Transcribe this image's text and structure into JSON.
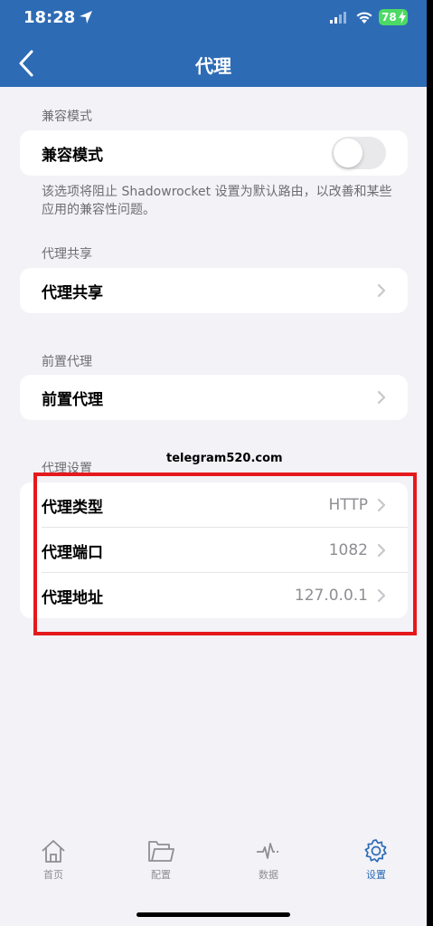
{
  "status_bar": {
    "time": "18:28",
    "battery": "78"
  },
  "nav": {
    "title": "代理"
  },
  "sections": {
    "compat": {
      "header": "兼容模式",
      "row_label": "兼容模式",
      "toggle_on": false,
      "footnote": "该选项将阻止 Shadowrocket 设置为默认路由，以改善和某些应用的兼容性问题。"
    },
    "share": {
      "header": "代理共享",
      "row_label": "代理共享"
    },
    "front": {
      "header": "前置代理",
      "row_label": "前置代理"
    },
    "settings": {
      "header": "代理设置",
      "rows": [
        {
          "label": "代理类型",
          "value": "HTTP"
        },
        {
          "label": "代理端口",
          "value": "1082"
        },
        {
          "label": "代理地址",
          "value": "127.0.0.1"
        }
      ]
    }
  },
  "watermark": "telegram520.com",
  "tabbar": {
    "tabs": [
      {
        "label": "首页",
        "icon": "home-icon"
      },
      {
        "label": "配置",
        "icon": "folder-icon"
      },
      {
        "label": "数据",
        "icon": "activity-icon"
      },
      {
        "label": "设置",
        "icon": "gear-icon"
      }
    ],
    "active_index": 3
  },
  "colors": {
    "accent": "#2d6bb5",
    "highlight_border": "#e5191c",
    "battery": "#4cd964"
  }
}
